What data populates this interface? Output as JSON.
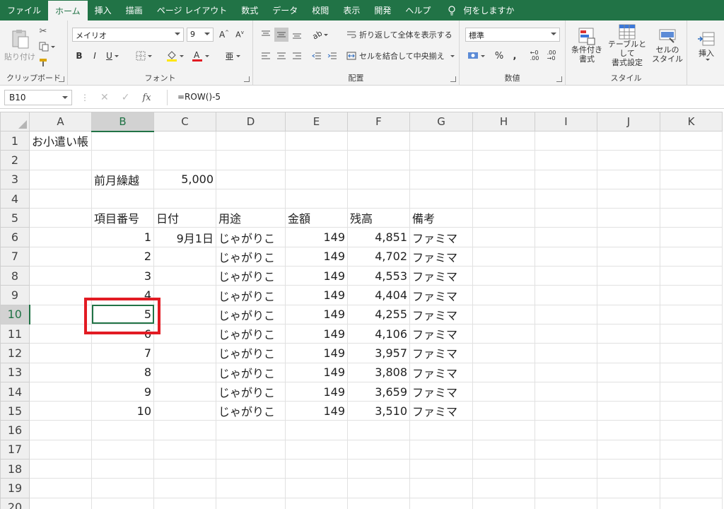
{
  "tabs": [
    "ファイル",
    "ホーム",
    "挿入",
    "描画",
    "ページ レイアウト",
    "数式",
    "データ",
    "校閲",
    "表示",
    "開発",
    "ヘルプ",
    "何をしますか"
  ],
  "active_tab": "ホーム",
  "ribbon": {
    "clipboard": {
      "paste": "貼り付け",
      "label": "クリップボード"
    },
    "font": {
      "name": "メイリオ",
      "size": "9",
      "bold": "B",
      "italic": "I",
      "underline": "U",
      "label": "フォント"
    },
    "alignment": {
      "wrap": "折り返して全体を表示する",
      "merge": "セルを結合して中央揃え",
      "label": "配置"
    },
    "number": {
      "format": "標準",
      "percent": "%",
      "comma": ",",
      "label": "数値"
    },
    "styles": {
      "conditional": "条件付き\n書式",
      "table": "テーブルとして\n書式設定",
      "cell": "セルの\nスタイル",
      "label": "スタイル"
    },
    "cells": {
      "insert": "挿入"
    }
  },
  "formula_bar": {
    "name_box": "B10",
    "formula": "=ROW()-5",
    "fx": "fx"
  },
  "columns": [
    "A",
    "B",
    "C",
    "D",
    "E",
    "F",
    "G",
    "H",
    "I",
    "J",
    "K"
  ],
  "rows": [
    {
      "n": "1",
      "A": "お小遣い帳",
      "B": "",
      "C": "",
      "D": "",
      "E": "",
      "F": "",
      "G": ""
    },
    {
      "n": "2",
      "A": "",
      "B": "",
      "C": "",
      "D": "",
      "E": "",
      "F": "",
      "G": ""
    },
    {
      "n": "3",
      "A": "",
      "B": "前月繰越",
      "C": "5,000",
      "D": "",
      "E": "",
      "F": "",
      "G": ""
    },
    {
      "n": "4",
      "A": "",
      "B": "",
      "C": "",
      "D": "",
      "E": "",
      "F": "",
      "G": ""
    },
    {
      "n": "5",
      "A": "",
      "B": "項目番号",
      "C": "日付",
      "D": "用途",
      "E": "金額",
      "F": "残高",
      "G": "備考"
    },
    {
      "n": "6",
      "A": "",
      "B": "1",
      "C": "9月1日",
      "D": "じゃがりこ",
      "E": "149",
      "F": "4,851",
      "G": "ファミマ"
    },
    {
      "n": "7",
      "A": "",
      "B": "2",
      "C": "",
      "D": "じゃがりこ",
      "E": "149",
      "F": "4,702",
      "G": "ファミマ"
    },
    {
      "n": "8",
      "A": "",
      "B": "3",
      "C": "",
      "D": "じゃがりこ",
      "E": "149",
      "F": "4,553",
      "G": "ファミマ"
    },
    {
      "n": "9",
      "A": "",
      "B": "4",
      "C": "",
      "D": "じゃがりこ",
      "E": "149",
      "F": "4,404",
      "G": "ファミマ"
    },
    {
      "n": "10",
      "A": "",
      "B": "5",
      "C": "",
      "D": "じゃがりこ",
      "E": "149",
      "F": "4,255",
      "G": "ファミマ"
    },
    {
      "n": "11",
      "A": "",
      "B": "6",
      "C": "",
      "D": "じゃがりこ",
      "E": "149",
      "F": "4,106",
      "G": "ファミマ"
    },
    {
      "n": "12",
      "A": "",
      "B": "7",
      "C": "",
      "D": "じゃがりこ",
      "E": "149",
      "F": "3,957",
      "G": "ファミマ"
    },
    {
      "n": "13",
      "A": "",
      "B": "8",
      "C": "",
      "D": "じゃがりこ",
      "E": "149",
      "F": "3,808",
      "G": "ファミマ"
    },
    {
      "n": "14",
      "A": "",
      "B": "9",
      "C": "",
      "D": "じゃがりこ",
      "E": "149",
      "F": "3,659",
      "G": "ファミマ"
    },
    {
      "n": "15",
      "A": "",
      "B": "10",
      "C": "",
      "D": "じゃがりこ",
      "E": "149",
      "F": "3,510",
      "G": "ファミマ"
    },
    {
      "n": "16",
      "A": "",
      "B": "",
      "C": "",
      "D": "",
      "E": "",
      "F": "",
      "G": ""
    },
    {
      "n": "17",
      "A": "",
      "B": "",
      "C": "",
      "D": "",
      "E": "",
      "F": "",
      "G": ""
    },
    {
      "n": "18",
      "A": "",
      "B": "",
      "C": "",
      "D": "",
      "E": "",
      "F": "",
      "G": ""
    },
    {
      "n": "19",
      "A": "",
      "B": "",
      "C": "",
      "D": "",
      "E": "",
      "F": "",
      "G": ""
    },
    {
      "n": "20",
      "A": "",
      "B": "",
      "C": "",
      "D": "",
      "E": "",
      "F": "",
      "G": ""
    }
  ],
  "selected": {
    "col": "B",
    "row": "10"
  },
  "colors": {
    "accent": "#217346",
    "highlight": "#e21b23"
  }
}
